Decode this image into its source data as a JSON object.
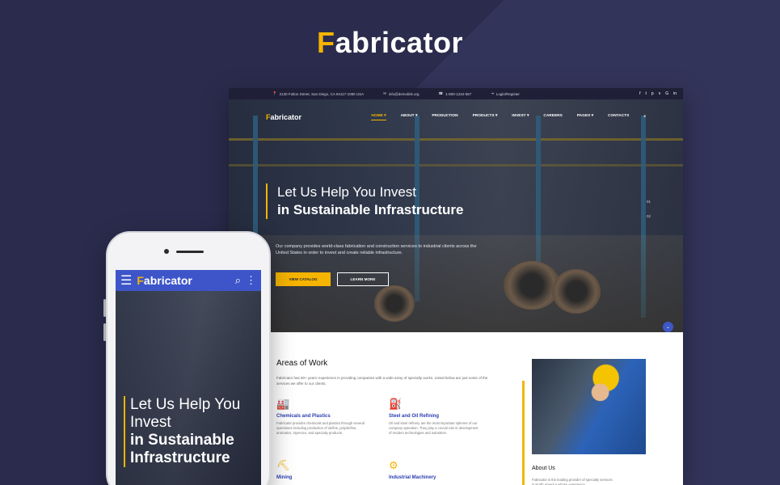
{
  "brand": {
    "initial": "F",
    "rest": "abricator"
  },
  "desktop": {
    "topbar": {
      "address": "2130 Fulton Street, San Diego, CA 94117-1080 USA",
      "email": "info@demolink.org",
      "phone": "1-800-1234-567",
      "login": "Login/Register",
      "social": [
        "f",
        "t",
        "p",
        "v",
        "G",
        "in"
      ]
    },
    "nav": {
      "logo_initial": "F",
      "logo_rest": "abricator",
      "items": [
        "HOME ▾",
        "ABOUT ▾",
        "PRODUCTION",
        "PRODUCTS ▾",
        "INVEST ▾",
        "CAREERS",
        "PAGES ▾",
        "CONTACTS"
      ],
      "search_icon": "⌕"
    },
    "hero": {
      "line1": "Let Us Help You Invest",
      "line2": "in Sustainable Infrastructure",
      "description": "Our company provides world-class fabrication and construction services to industrial clients across the United States in order to invest and create reliable infrastructure.",
      "btn_primary": "VIEW CATALOG",
      "btn_secondary": "LEARN MORE",
      "slide_1": "01",
      "slide_2": "02"
    },
    "scroll_icon": "⌄",
    "areas": {
      "title": "Areas of Work",
      "description": "Fabricator has 50+ years' experience in providing companies with a wide array of specialty works. Listed below are just some of the services we offer to our clients.",
      "items": [
        {
          "icon": "🏭",
          "title": "Chemicals and Plastics",
          "desc": "Fabricator provides chemicals and plastics through several operations including production of olefins, polyolefins, aromatics, styrenics, and specialty products."
        },
        {
          "icon": "⛽",
          "title": "Steel and Oil Refining",
          "desc": "Oil and steel refinery are the most important spheres of our company operation. They play a crucial role in development of modern technologies and industries."
        },
        {
          "icon": "⛏",
          "title": "Mining",
          "desc": ""
        },
        {
          "icon": "⚙",
          "title": "Industrial Machinery",
          "desc": ""
        }
      ]
    },
    "about": {
      "title": "About Us",
      "desc": "Fabricator is the leading provider of specialty services in North America whose experience"
    }
  },
  "phone": {
    "logo_initial": "F",
    "logo_rest": "abricator",
    "menu_icon": "☰",
    "search_icon": "⌕",
    "more_icon": "⋮",
    "line1a": "Let Us Help You",
    "line1b": "Invest",
    "line2a": "in Sustainable",
    "line2b": "Infrastructure"
  }
}
